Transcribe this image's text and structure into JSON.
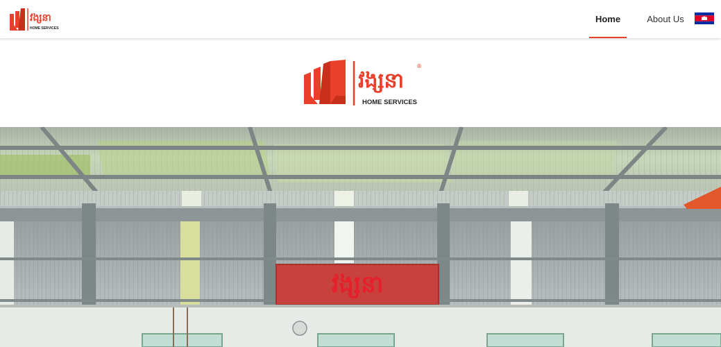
{
  "nav": {
    "logo_brand": "វង្សនា",
    "logo_sub": "HOME SERVICES",
    "links": [
      {
        "label": "Home",
        "active": true
      },
      {
        "label": "About Us",
        "active": false
      }
    ],
    "language_flag": "cambodia-flag-icon"
  },
  "hero": {
    "logo_brand": "វង្សនា",
    "logo_sub": "HOME SERVICES",
    "registered_mark": "®"
  },
  "banner": {
    "sign_text": "វង្សនា"
  },
  "colors": {
    "brand_red": "#e8402a",
    "brand_dark_red": "#c9301c",
    "nav_active_underline": "#e8402a",
    "sign_background": "#c8423d"
  }
}
